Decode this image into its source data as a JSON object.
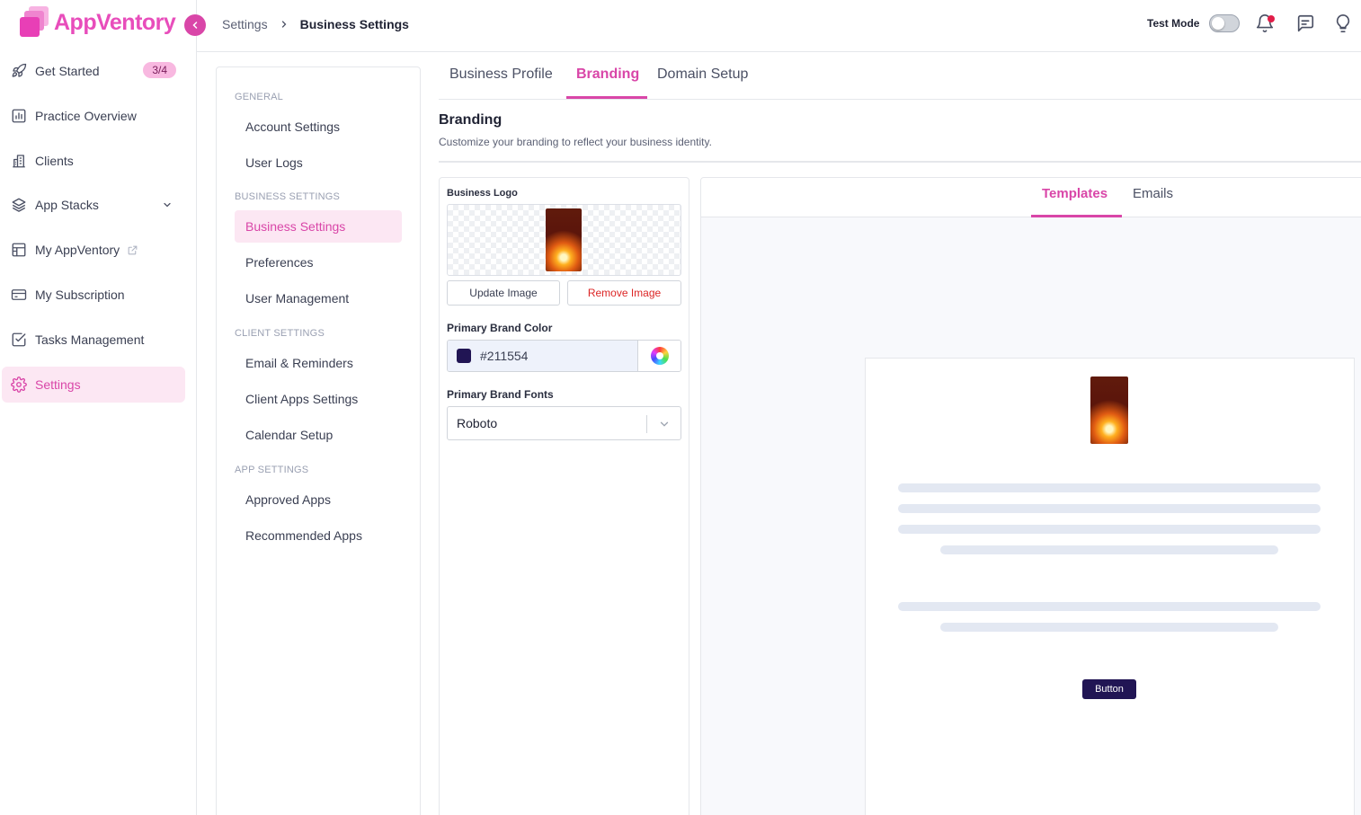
{
  "app": {
    "name": "AppVentory",
    "accent": "#d946a8"
  },
  "leftnav": {
    "items": [
      {
        "label": "Get Started",
        "icon": "rocket-icon",
        "badge": "3/4"
      },
      {
        "label": "Practice Overview",
        "icon": "chart-icon"
      },
      {
        "label": "Clients",
        "icon": "building-icon"
      },
      {
        "label": "App Stacks",
        "icon": "layers-icon"
      },
      {
        "label": "My AppVentory",
        "icon": "store-icon"
      },
      {
        "label": "My Subscription",
        "icon": "credit-card-icon"
      },
      {
        "label": "Tasks Management",
        "icon": "checkbox-icon"
      },
      {
        "label": "Settings",
        "icon": "gear-icon",
        "active": true
      }
    ]
  },
  "topbar": {
    "breadcrumb": {
      "parent": "Settings",
      "current": "Business Settings"
    },
    "test_mode_label": "Test Mode",
    "test_mode_on": false
  },
  "settings_menu": {
    "sections": [
      {
        "label": "GENERAL",
        "items": [
          "Account Settings",
          "User Logs"
        ]
      },
      {
        "label": "BUSINESS SETTINGS",
        "items": [
          "Business Settings",
          "Preferences",
          "User Management"
        ]
      },
      {
        "label": "CLIENT SETTINGS",
        "items": [
          "Email & Reminders",
          "Client Apps Settings",
          "Calendar Setup"
        ]
      },
      {
        "label": "APP SETTINGS",
        "items": [
          "Approved Apps",
          "Recommended Apps"
        ]
      }
    ],
    "active_item": "Business Settings"
  },
  "tabs": [
    "Business Profile",
    "Branding",
    "Domain Setup"
  ],
  "active_tab": "Branding",
  "branding": {
    "title": "Branding",
    "subtitle": "Customize your branding to reflect your business identity.",
    "logo_label": "Business Logo",
    "update_button": "Update Image",
    "remove_button": "Remove Image",
    "color_label": "Primary Brand Color",
    "color_value": "#211554",
    "font_label": "Primary Brand Fonts",
    "font_value": "Roboto"
  },
  "preview": {
    "tabs": [
      "Templates",
      "Emails"
    ],
    "active_tab": "Templates",
    "button_label": "Button",
    "button_color": "#211554"
  }
}
